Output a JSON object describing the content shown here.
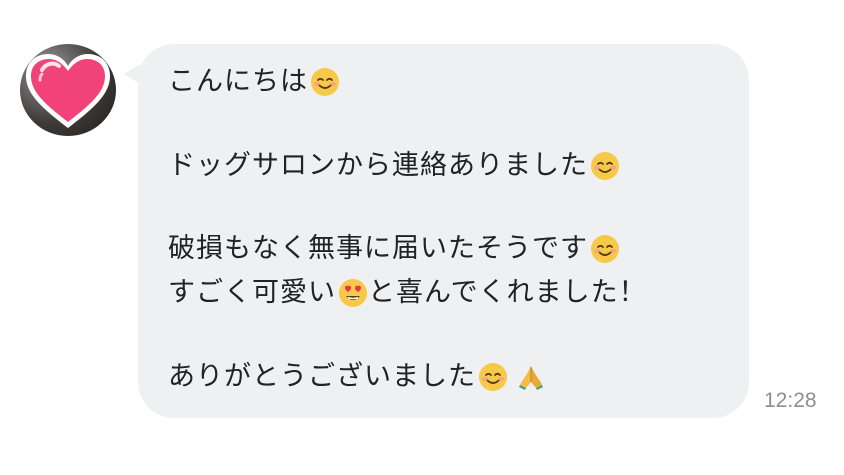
{
  "chat": {
    "sender": {
      "avatar_icon": "heart-avatar-icon"
    },
    "message": {
      "line1": "こんにちは",
      "line2": "ドッグサロンから連絡ありました",
      "line3": "破損もなく無事に届いたそうです",
      "line4a": "すごく可愛い",
      "line4b": "と喜んでくれました！",
      "line5": "ありがとうございました",
      "emojis": [
        "smiling-face-icon",
        "heart-eyes-icon",
        "folded-hands-icon"
      ]
    },
    "timestamp": "12:28"
  },
  "colors": {
    "bubble": "#eff0f2",
    "text": "#222222",
    "timestamp": "#8a8f96",
    "heart": "#f2427a"
  }
}
